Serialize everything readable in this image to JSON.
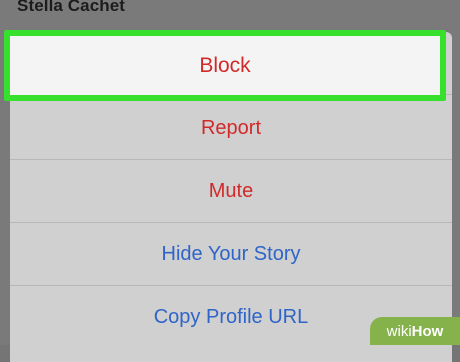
{
  "profile": {
    "name": "Stella Cachet"
  },
  "actions": [
    {
      "label": "Block",
      "color": "#d12a2a",
      "highlighted": true
    },
    {
      "label": "Report",
      "color": "#d12a2a"
    },
    {
      "label": "Mute",
      "color": "#d12a2a"
    },
    {
      "label": "Hide Your Story",
      "color": "#2f64c8"
    },
    {
      "label": "Copy Profile URL",
      "color": "#2f64c8"
    }
  ],
  "highlight_color": "#37e02d",
  "watermark": {
    "wiki": "wiki",
    "how": "How"
  }
}
